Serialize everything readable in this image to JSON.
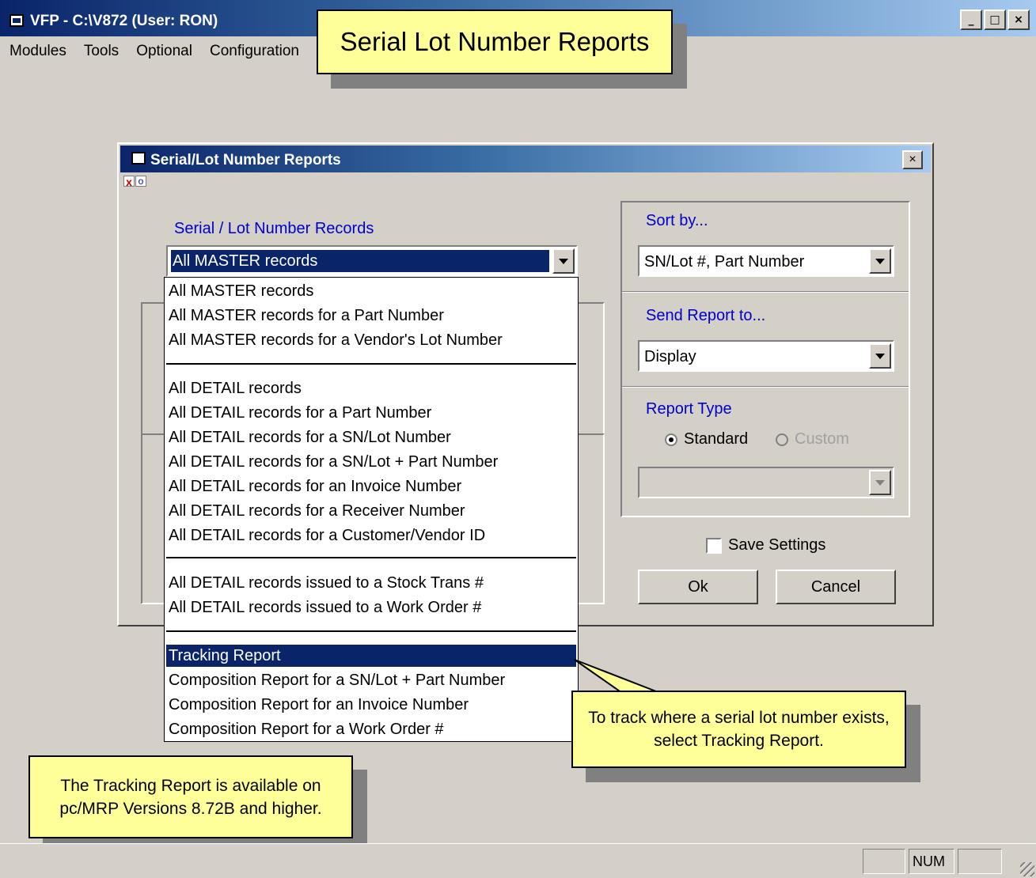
{
  "app": {
    "title": "VFP - C:\\V872  (User: RON)",
    "window_buttons": {
      "minimize": "_",
      "maximize": "□",
      "close": "×"
    }
  },
  "menu": {
    "items": [
      "Modules",
      "Tools",
      "Optional",
      "Configuration"
    ]
  },
  "callouts": {
    "title": "Serial Lot Number Reports",
    "tracking_tip": "To track where a serial lot number exists, select Tracking Report.",
    "version_tip": "The Tracking Report is available on pc/MRP Versions 8.72B and higher."
  },
  "dialog": {
    "title": "Serial/Lot Number Reports",
    "close": "×",
    "records": {
      "label": "Serial / Lot Number Records",
      "selected": "All MASTER records"
    },
    "sort_by": {
      "label": "Sort by...",
      "selected": "SN/Lot #, Part Number"
    },
    "send_to": {
      "label": "Send Report to...",
      "selected": "Display"
    },
    "report_type": {
      "label": "Report Type",
      "standard": "Standard",
      "custom": "Custom"
    },
    "save_settings": "Save Settings",
    "ok": "Ok",
    "cancel": "Cancel",
    "dropdown_items": [
      "All MASTER records",
      "All MASTER records for a Part Number",
      "All MASTER records for a Vendor's Lot Number",
      "All DETAIL records",
      "All DETAIL records for a Part Number",
      "All DETAIL records for a SN/Lot Number",
      "All DETAIL records for a SN/Lot + Part Number",
      "All DETAIL records for an Invoice Number",
      "All DETAIL records for a Receiver Number",
      "All DETAIL records for a Customer/Vendor ID",
      "All DETAIL records issued to a Stock Trans #",
      "All DETAIL records issued to a Work Order #",
      "Tracking Report",
      "Composition Report for a SN/Lot + Part Number",
      "Composition Report for an Invoice Number",
      "Composition Report for a Work Order #"
    ]
  },
  "status": {
    "num": "NUM"
  }
}
